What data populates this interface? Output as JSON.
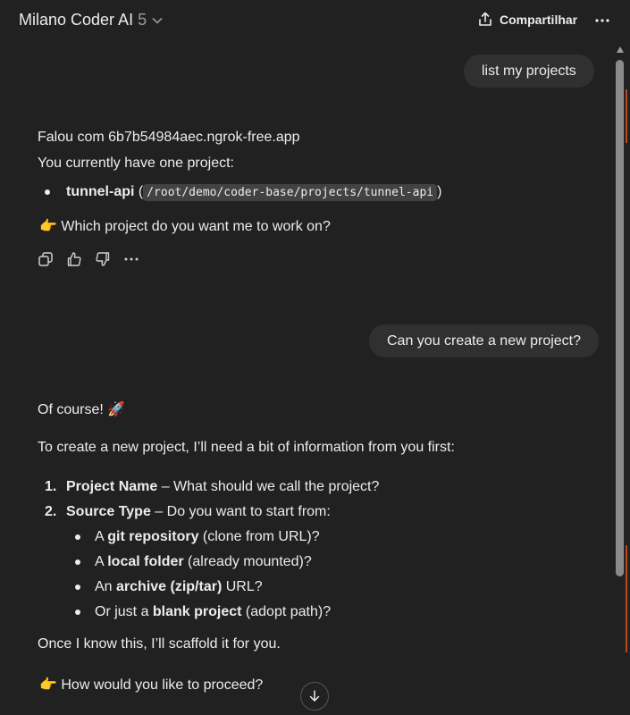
{
  "header": {
    "app_name": "Milano Coder AI",
    "version": "5",
    "share_label": "Compartilhar"
  },
  "messages": {
    "user1": "list my projects",
    "assistant1": {
      "line1": "Falou com 6b7b54984aec.ngrok-free.app",
      "line2": "You currently have one project:",
      "project_name": "tunnel-api",
      "paren_open": "(",
      "project_path": "/root/demo/coder-base/projects/tunnel-api",
      "paren_close": ")",
      "question_emoji": "👉",
      "question": "Which project do you want me to work on?"
    },
    "user2": "Can you create a new project?",
    "assistant2": {
      "intro_text": "Of course!",
      "intro_emoji": "🚀",
      "lead": "To create a new project, I’ll need a bit of information from you first:",
      "items": [
        {
          "num": "1.",
          "bold": "Project Name",
          "rest": " – What should we call the project?"
        },
        {
          "num": "2.",
          "bold": "Source Type",
          "rest": " – Do you want to start from:"
        }
      ],
      "sub_items": [
        {
          "pre": "A ",
          "bold": "git repository",
          "post": " (clone from URL)?"
        },
        {
          "pre": "A ",
          "bold": "local folder",
          "post": " (already mounted)?"
        },
        {
          "pre": "An ",
          "bold": "archive (zip/tar)",
          "post": " URL?"
        },
        {
          "pre": "Or just a ",
          "bold": "blank project",
          "post": " (adopt path)?"
        }
      ],
      "closing": "Once I know this, I’ll scaffold it for you.",
      "question_emoji": "👉",
      "question": "How would you like to proceed?"
    }
  },
  "icons": {
    "copy": "copy-icon",
    "thumbs_up": "thumbs-up-icon",
    "thumbs_down": "thumbs-down-icon",
    "more": "more-horizontal-icon",
    "share": "share-icon",
    "chevron": "chevron-down-icon",
    "scroll_down": "arrow-down-icon"
  },
  "colors": {
    "background": "#212121",
    "bubble": "#303030",
    "text": "#ececec",
    "muted": "#9b9b9b"
  }
}
